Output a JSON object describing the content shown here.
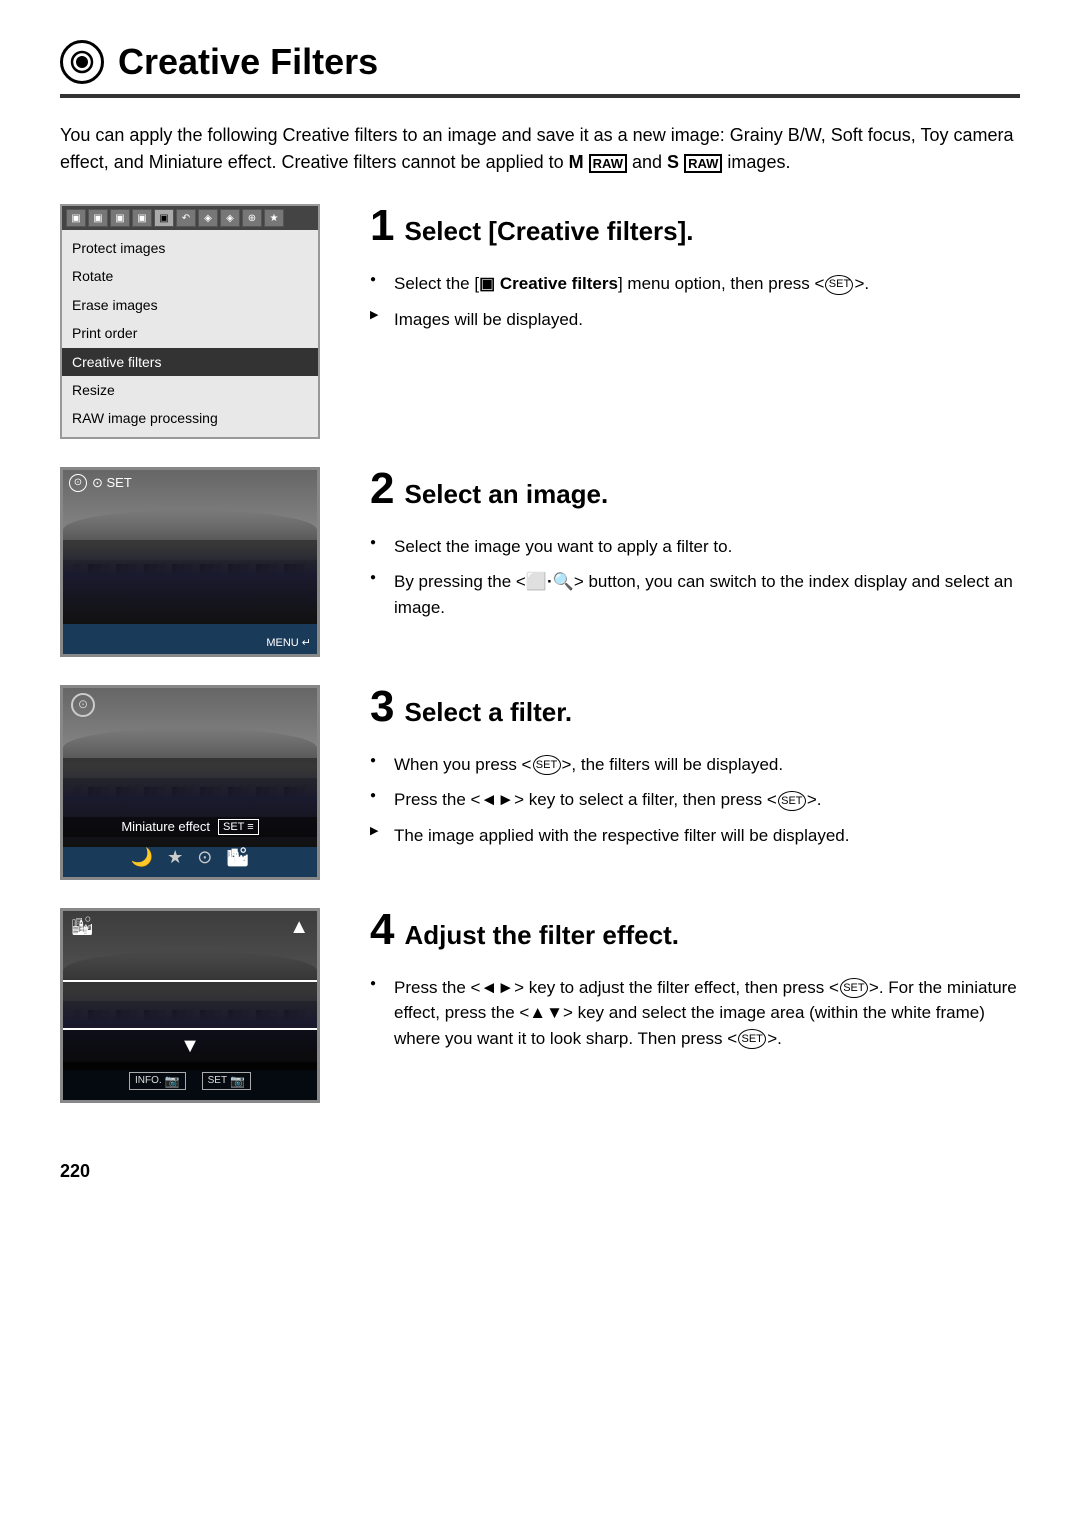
{
  "page": {
    "title": "Creative Filters",
    "page_number": "220",
    "intro": "You can apply the following Creative filters to an image and save it as a new image: Grainy B/W, Soft focus, Toy camera effect, and Miniature effect. Creative filters cannot be applied to M RAW and S RAW images."
  },
  "steps": [
    {
      "number": "1",
      "title": "Select [Creative filters].",
      "bullets": [
        {
          "type": "dot",
          "text": "Select the [Creative filters] menu option, then press <SET>."
        },
        {
          "type": "arrow",
          "text": "Images will be displayed."
        }
      ]
    },
    {
      "number": "2",
      "title": "Select an image.",
      "bullets": [
        {
          "type": "dot",
          "text": "Select the image you want to apply a filter to."
        },
        {
          "type": "dot",
          "text": "By pressing the <INDEX·Q> button, you can switch to the index display and select an image."
        }
      ]
    },
    {
      "number": "3",
      "title": "Select a filter.",
      "bullets": [
        {
          "type": "dot",
          "text": "When you press <SET>, the filters will be displayed."
        },
        {
          "type": "dot",
          "text": "Press the <◄►> key to select a filter, then press <SET>."
        },
        {
          "type": "arrow",
          "text": "The image applied with the respective filter will be displayed."
        }
      ]
    },
    {
      "number": "4",
      "title": "Adjust the filter effect.",
      "bullets": [
        {
          "type": "dot",
          "text": "Press the <◄►> key to adjust the filter effect, then press <SET>. For the miniature effect, press the <▲▼> key and select the image area (within the white frame) where you want it to look sharp. Then press <SET>."
        }
      ]
    }
  ],
  "menu": {
    "items": [
      {
        "label": "Protect images",
        "selected": false
      },
      {
        "label": "Rotate",
        "selected": false
      },
      {
        "label": "Erase images",
        "selected": false
      },
      {
        "label": "Print order",
        "selected": false
      },
      {
        "label": "Creative filters",
        "selected": true
      },
      {
        "label": "Resize",
        "selected": false
      },
      {
        "label": "RAW image processing",
        "selected": false
      }
    ]
  },
  "lcd_labels": {
    "step2_top": "⊙ SET",
    "step2_bottom": "MENU ↵",
    "step3_filter": "Miniature effect",
    "step3_set": "SET ≡"
  }
}
